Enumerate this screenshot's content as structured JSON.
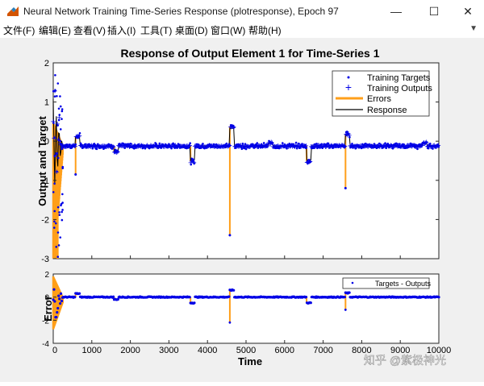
{
  "window": {
    "title": "Neural Network Training Time-Series Response (plotresponse), Epoch 97",
    "minimize_icon": "minimize-icon",
    "maximize_icon": "maximize-icon",
    "close_icon": "close-icon"
  },
  "menu": {
    "items": [
      "文件(F)",
      "编辑(E)",
      "查看(V)",
      "插入(I)",
      "工具(T)",
      "桌面(D)",
      "窗口(W)",
      "帮助(H)"
    ],
    "overflow_icon": "chevron-down-icon"
  },
  "watermark": "知乎 @紫极神光",
  "colors": {
    "targets": "#0000e6",
    "outputs": "#0000e6",
    "errors": "#ff9f1a",
    "response": "#000000",
    "figure_bg": "#f0f0f0"
  },
  "chart_data": [
    {
      "type": "line",
      "title": "Response of Output Element 1 for Time-Series 1",
      "xlabel": "",
      "ylabel": "Output and Target",
      "xlim": [
        0,
        10000
      ],
      "ylim": [
        -3,
        2
      ],
      "yticks": [
        -3,
        -2,
        -1,
        0,
        1,
        2
      ],
      "grid": false,
      "legend_position": "top-right",
      "legend": [
        "Training Targets",
        "Training Outputs",
        "Errors",
        "Response"
      ],
      "baseline": -0.12,
      "initial_transient": {
        "x_range": [
          0,
          250
        ],
        "targets_max": 2.0,
        "targets_min": -3.0,
        "errors_min": -3.0
      },
      "events": [
        {
          "x": 580,
          "pulse": 0.25,
          "target_spike": -0.85
        },
        {
          "x": 1580,
          "pulse": -0.15,
          "target_spike": null
        },
        {
          "x": 3560,
          "pulse": -0.4,
          "target_spike": null
        },
        {
          "x": 4580,
          "pulse": 0.5,
          "target_spike": -2.4
        },
        {
          "x": 5580,
          "pulse": 0.08,
          "target_spike": null
        },
        {
          "x": 6570,
          "pulse": -0.4,
          "target_spike": null
        },
        {
          "x": 7580,
          "pulse": 0.3,
          "target_spike": -1.2
        },
        {
          "x": 9580,
          "pulse": 0.08,
          "target_spike": null
        }
      ]
    },
    {
      "type": "line",
      "title": "",
      "xlabel": "Time",
      "ylabel": "Error",
      "xlim": [
        0,
        10000
      ],
      "ylim": [
        -4,
        2
      ],
      "xticks": [
        1000,
        2000,
        3000,
        4000,
        5000,
        6000,
        7000,
        8000,
        9000,
        10000
      ],
      "yticks": [
        -4,
        -2,
        0,
        2
      ],
      "xtick_labels": [
        "1000",
        "2000",
        "3000",
        "4000",
        "5000",
        "6000",
        "7000",
        "8000",
        "9000",
        "10000"
      ],
      "partial_xtick_label": "0",
      "legend_position": "top-right",
      "legend": [
        "Targets - Outputs"
      ],
      "baseline": 0.0,
      "events": [
        {
          "x": 580,
          "pulse": 0.3
        },
        {
          "x": 1580,
          "pulse": -0.2
        },
        {
          "x": 3560,
          "pulse": -0.5
        },
        {
          "x": 4580,
          "pulse": 0.6,
          "spike": -2.2
        },
        {
          "x": 6570,
          "pulse": -0.5
        },
        {
          "x": 7580,
          "pulse": 0.35,
          "spike": -1.1
        }
      ]
    }
  ]
}
